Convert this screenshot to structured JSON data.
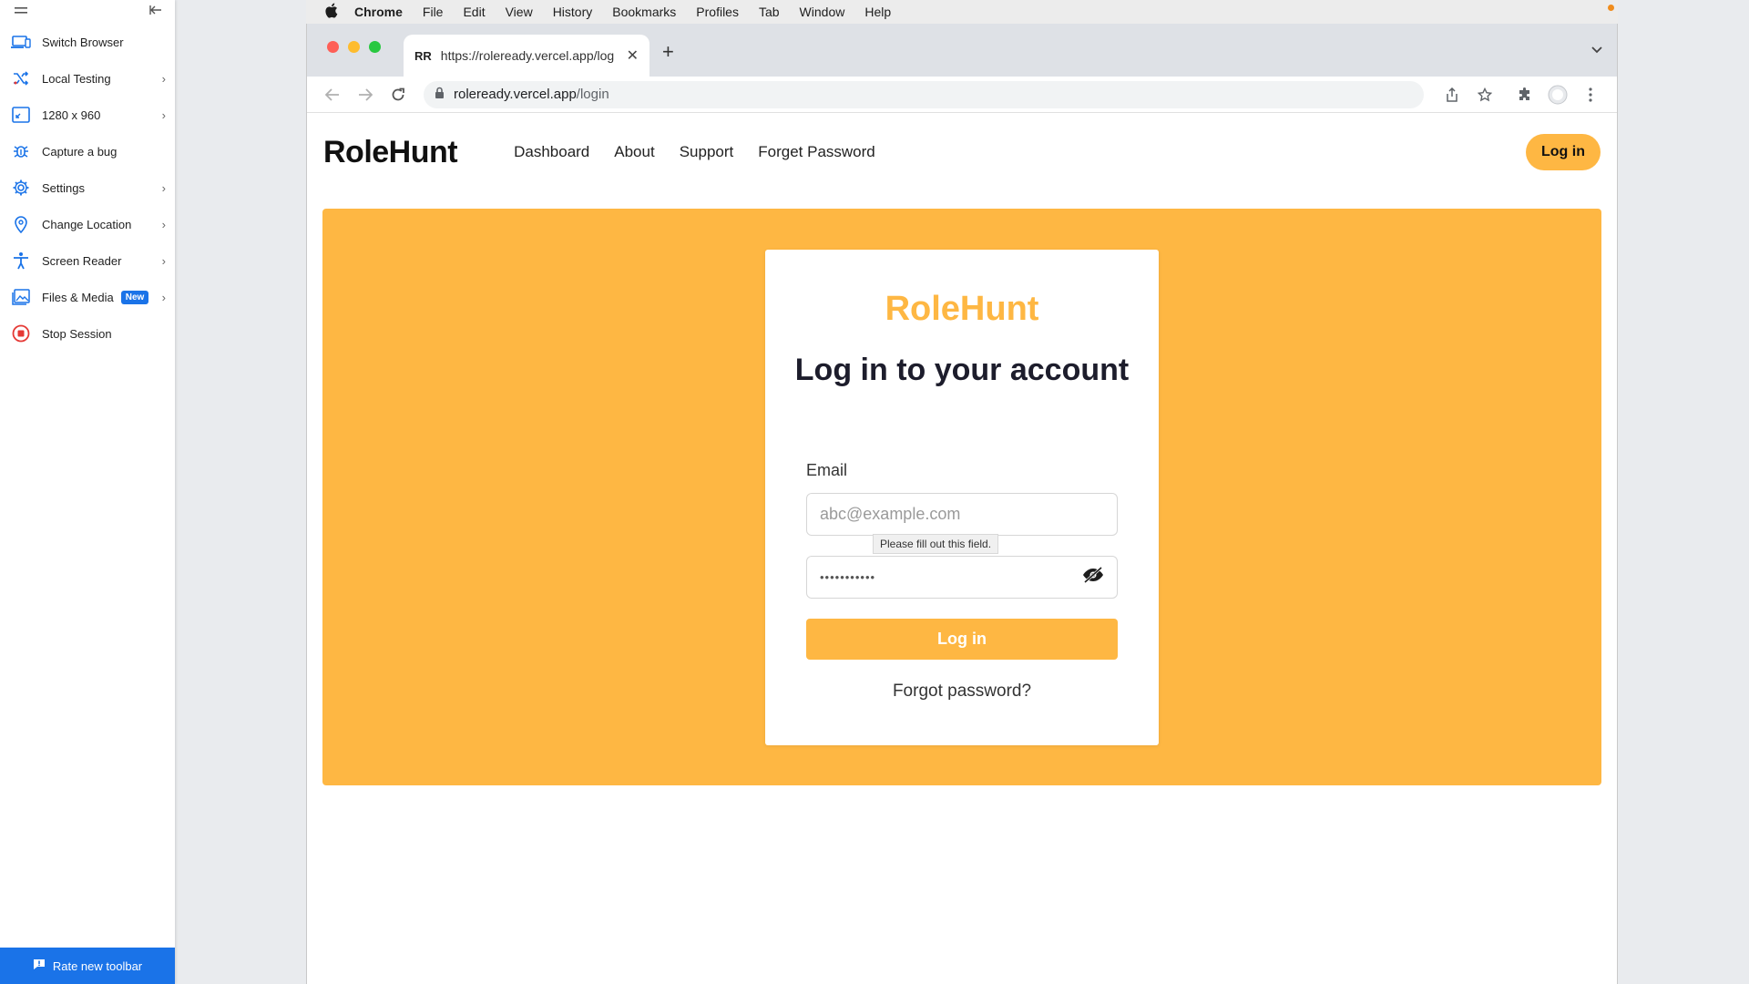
{
  "toolbar": {
    "items": [
      {
        "label": "Switch Browser",
        "icon": "devices-icon",
        "chevron": false
      },
      {
        "label": "Local Testing",
        "icon": "shuffle-icon",
        "chevron": true
      },
      {
        "label": "1280 x 960",
        "icon": "resolution-icon",
        "chevron": true
      },
      {
        "label": "Capture a bug",
        "icon": "bug-icon",
        "chevron": false
      },
      {
        "label": "Settings",
        "icon": "gear-icon",
        "chevron": true
      },
      {
        "label": "Change Location",
        "icon": "location-pin-icon",
        "chevron": true
      },
      {
        "label": "Screen Reader",
        "icon": "accessibility-icon",
        "chevron": true
      },
      {
        "label": "Files & Media",
        "icon": "image-icon",
        "chevron": true,
        "badge": "New"
      },
      {
        "label": "Stop Session",
        "icon": "stop-icon",
        "chevron": false
      }
    ],
    "rate_label": "Rate new toolbar",
    "accent": "#1a73e8"
  },
  "menubar": {
    "items": [
      "Chrome",
      "File",
      "Edit",
      "View",
      "History",
      "Bookmarks",
      "Profiles",
      "Tab",
      "Window",
      "Help"
    ]
  },
  "browser": {
    "tab": {
      "favicon": "RR",
      "title": "https://roleready.vercel.app/log"
    },
    "url_host": "roleready.vercel.app",
    "url_path": "/login"
  },
  "site": {
    "logo": "RoleHunt",
    "nav": [
      "Dashboard",
      "About",
      "Support",
      "Forget Password"
    ],
    "login_button": "Log in",
    "accent": "#feb743"
  },
  "card": {
    "logo": "RoleHunt",
    "heading": "Log in to your account",
    "email_label": "Email",
    "email_placeholder": "abc@example.com",
    "tooltip": "Please fill out this field.",
    "password_mask": "•••••••••••",
    "login_button": "Log in",
    "forgot": "Forgot password?"
  }
}
